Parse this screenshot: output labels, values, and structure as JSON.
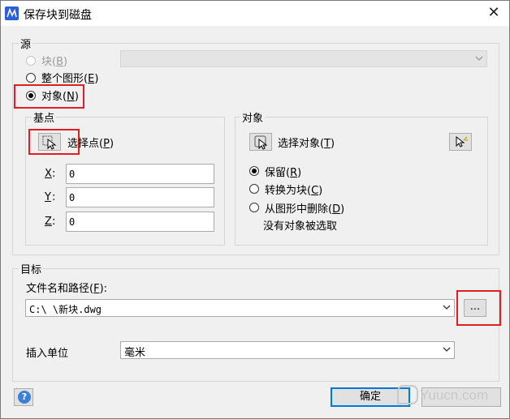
{
  "window": {
    "title": "保存块到磁盘",
    "close_glyph": "✕"
  },
  "source": {
    "label": "源",
    "block": {
      "label": "块",
      "key": "B",
      "selected": false,
      "enabled": false
    },
    "whole_drawing": {
      "label": "整个图形",
      "key": "E",
      "selected": false
    },
    "objects": {
      "label": "对象",
      "key": "N",
      "selected": true
    },
    "block_combo_value": ""
  },
  "base_point": {
    "label": "基点",
    "pick_label": "选择点",
    "pick_key": "P",
    "x": {
      "label": "X",
      "value": "0"
    },
    "y": {
      "label": "Y",
      "value": "0"
    },
    "z": {
      "label": "Z",
      "value": "0"
    }
  },
  "objects": {
    "label": "对象",
    "select_label": "选择对象",
    "select_key": "T",
    "retain": {
      "label": "保留",
      "key": "R",
      "selected": true
    },
    "convert": {
      "label": "转换为块",
      "key": "C",
      "selected": false
    },
    "delete": {
      "label": "从图形中删除",
      "key": "D",
      "selected": false
    },
    "status": "没有对象被选取"
  },
  "destination": {
    "label": "目标",
    "file_label": "文件名和路径",
    "file_key": "F",
    "file_value": "C:\\          \\新块.dwg",
    "browse_label": "...",
    "units_label": "插入单位",
    "units_value": "毫米"
  },
  "buttons": {
    "ok": "确定",
    "help": "?"
  },
  "watermark": "Yuucn.com"
}
